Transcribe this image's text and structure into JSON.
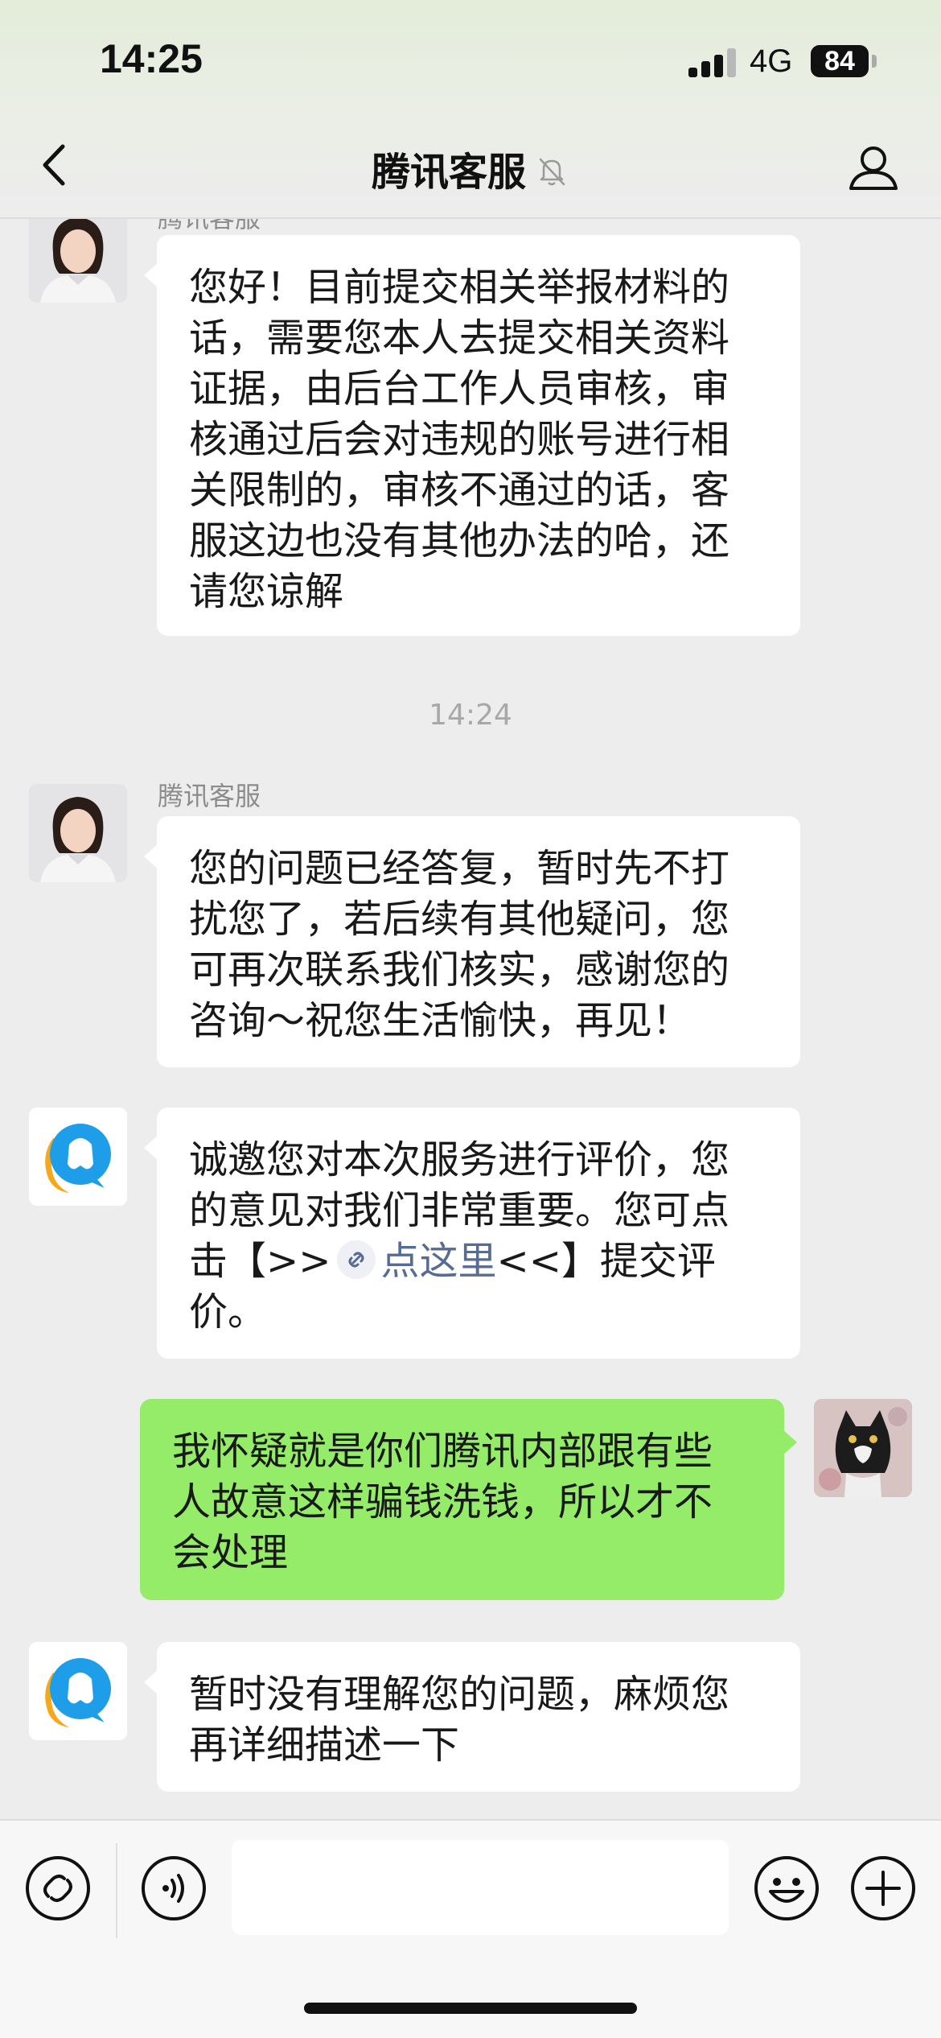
{
  "status_bar": {
    "time": "14:25",
    "network": "4G",
    "battery": "84"
  },
  "nav": {
    "title": "腾讯客服"
  },
  "messages": {
    "m0": {
      "sender_partial": "腾讯客服",
      "lines": [
        "您好！目前提交相关举报材料的",
        "话，需要您本人去提交相关资料",
        "证据，由后台工作人员审核，审",
        "核通过后会对违规的账号进行相",
        "关限制的，审核不通过的话，客",
        "服这边也没有其他办法的哈，还",
        "请您谅解"
      ]
    },
    "timestamp": "14:24",
    "m1": {
      "sender": "腾讯客服",
      "lines": [
        "您的问题已经答复，暂时先不打",
        "扰您了，若后续有其他疑问，您",
        "可再次联系我们核实，感谢您的",
        "咨询～祝您生活愉快，再见！"
      ]
    },
    "m2": {
      "lines": [
        "诚邀您对本次服务进行评价，您",
        "的意见对我们非常重要。您可点"
      ],
      "line3_before": "击【>>",
      "link_text": "点这里",
      "line3_after": "<<】提交评",
      "line4": "价。"
    },
    "m3": {
      "lines": [
        "我怀疑就是你们腾讯内部跟有些",
        "人故意这样骗钱洗钱，所以才不",
        "会处理"
      ]
    },
    "m4": {
      "lines": [
        "暂时没有理解您的问题，麻烦您",
        "再详细描述一下"
      ]
    }
  },
  "input": {
    "value": ""
  },
  "colors": {
    "my_bubble": "#95ec69",
    "link": "#576b95",
    "background": "#ededed"
  },
  "icons": [
    "back-icon",
    "mute-bell-icon",
    "profile-icon",
    "mini-program-icon",
    "voice-icon",
    "emoji-icon",
    "plus-icon",
    "qq-penguin-icon",
    "link-chain-icon"
  ]
}
